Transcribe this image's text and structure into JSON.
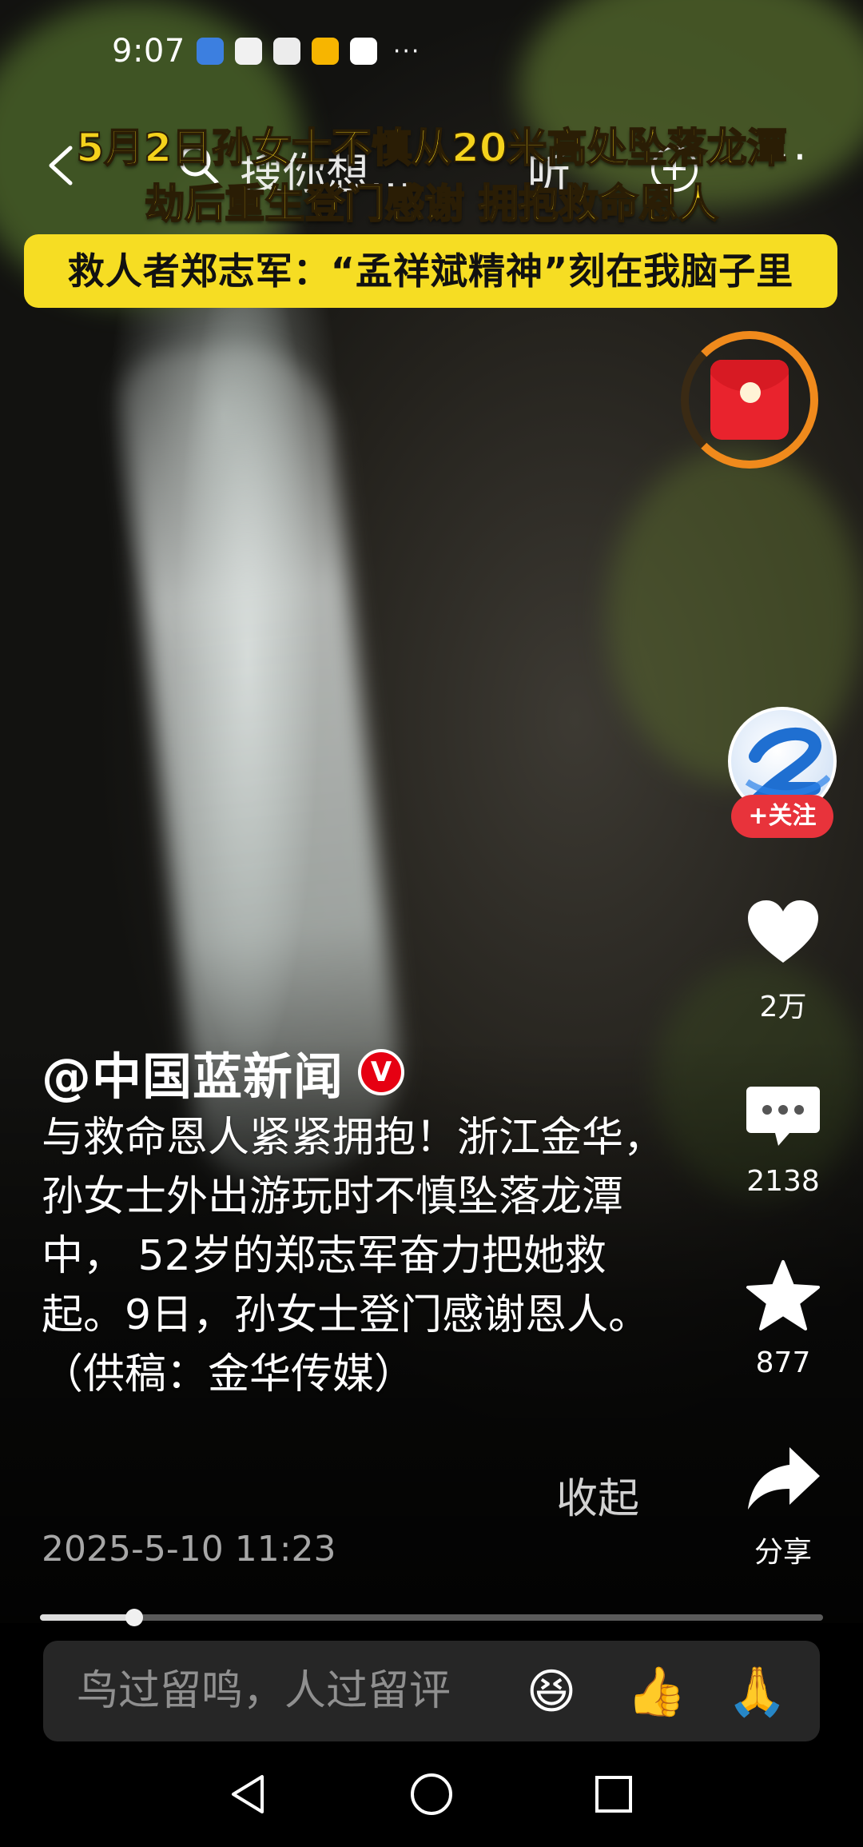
{
  "status_bar": {
    "time": "9:07",
    "icons": [
      "shield-app-icon",
      "huawei-app-icon",
      "huawei-store-icon",
      "weibo-icon",
      "payment-app-icon"
    ],
    "more": "···"
  },
  "top_nav": {
    "search_placeholder": "搜你想…",
    "listen_label": "听",
    "more_label": "···"
  },
  "headline": {
    "line1": "5月2日孙女士不慎从20米高处坠落龙潭",
    "line2": "劫后重生登门感谢  拥抱救命恩人",
    "subhead": "救人者郑志军：“孟祥斌精神”刻在我脑子里"
  },
  "rail": {
    "follow_label": "+关注",
    "likes": "2万",
    "comments": "2138",
    "favorites": "877",
    "share_label": "分享"
  },
  "post": {
    "author": "@中国蓝新闻",
    "verified_badge": "V",
    "caption": "与救命恩人紧紧拥抱！浙江金华，孙女士外出游玩时不慎坠落龙潭中， 52岁的郑志军奋力把她救起。9日，孙女士登门感谢恩人。（供稿：金华传媒）",
    "collapse_label": "收起",
    "timestamp": "2025-5-10 11:23"
  },
  "player": {
    "progress": 0.12
  },
  "comment_bar": {
    "placeholder": "鸟过留鸣，人过留评",
    "emojis": [
      "😆",
      "👍",
      "🙏"
    ]
  },
  "colors": {
    "headline_yellow": "#f4d21c",
    "subhead_bg": "#f6dd23",
    "follow_red": "#e8333b",
    "redpack_ring": "#f08a1c"
  }
}
